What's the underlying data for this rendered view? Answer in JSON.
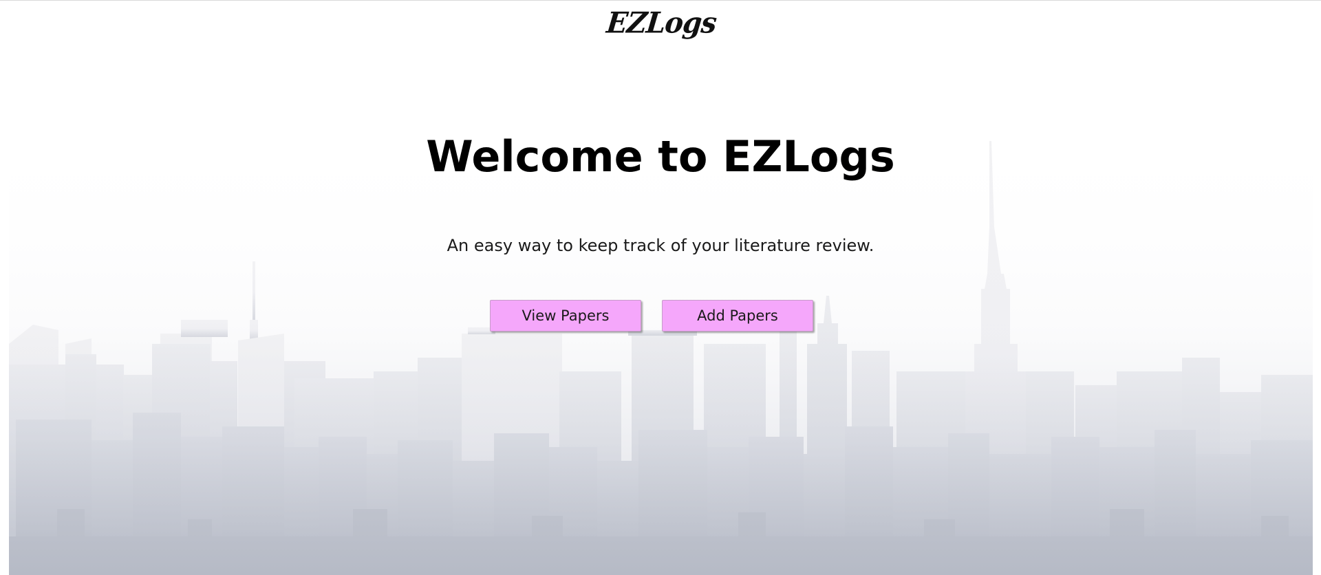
{
  "app": {
    "logo_text": "EZLogs"
  },
  "hero": {
    "title": "Welcome to EZLogs",
    "subtitle": "An easy way to keep track of your literature review."
  },
  "actions": {
    "view_papers_label": "View Papers",
    "add_papers_label": "Add Papers"
  },
  "colors": {
    "button_bg": "#f5a7fb",
    "page_bg": "#ffffff",
    "skyline_top": "#f4f4f6",
    "skyline_bottom": "#b9bdc8"
  },
  "background": {
    "illustration": "city-skyline"
  }
}
